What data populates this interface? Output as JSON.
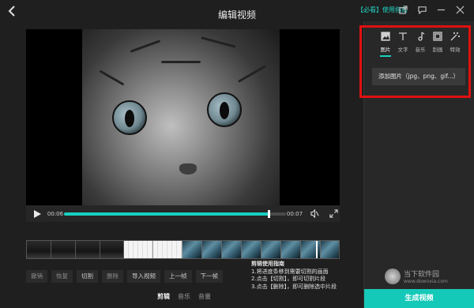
{
  "header": {
    "back_icon": "back-arrow-icon",
    "title": "编辑视频",
    "guide_link": "【必看】使用指南",
    "window_icons": [
      "share-icon",
      "feedback-icon",
      "minimize-icon",
      "close-icon"
    ]
  },
  "player": {
    "current_time": "00:06",
    "end_time": "00:07",
    "progress": 0.92
  },
  "edit_buttons": [
    {
      "label": "撤销",
      "enabled": false
    },
    {
      "label": "恢复",
      "enabled": false
    },
    {
      "label": "切割",
      "enabled": true
    },
    {
      "label": "删除",
      "enabled": false
    },
    {
      "label": "导入视频",
      "enabled": true
    },
    {
      "label": "上一帧",
      "enabled": true
    },
    {
      "label": "下一帧",
      "enabled": true
    }
  ],
  "instructions": {
    "heading": "剪辑使用指南",
    "lines": [
      "1.将进度条移到需要切割的画面",
      "2.点击【切割】，即可切割片段",
      "3.点击【删除】，即可删除选中片段"
    ]
  },
  "bottom_tabs": [
    {
      "label": "剪辑",
      "active": true
    },
    {
      "label": "音乐",
      "active": false
    },
    {
      "label": "音量",
      "active": false
    }
  ],
  "right_panel": {
    "tabs": [
      {
        "label": "图片",
        "icon": "image-icon",
        "active": true
      },
      {
        "label": "文字",
        "icon": "text-icon",
        "active": false
      },
      {
        "label": "音乐",
        "icon": "music-icon",
        "active": false
      },
      {
        "label": "刮画",
        "icon": "frame-icon",
        "active": false
      },
      {
        "label": "特效",
        "icon": "magic-wand-icon",
        "active": false
      }
    ],
    "add_image_button": "添加图片（jpg、png、gif...）"
  },
  "generate_button": "生成视频",
  "watermark": {
    "title": "当下软件园",
    "subtitle": "www.downxia.com"
  },
  "colors": {
    "accent": "#19d0c0",
    "highlight": "#e01010",
    "background": "#1f1f1f"
  }
}
